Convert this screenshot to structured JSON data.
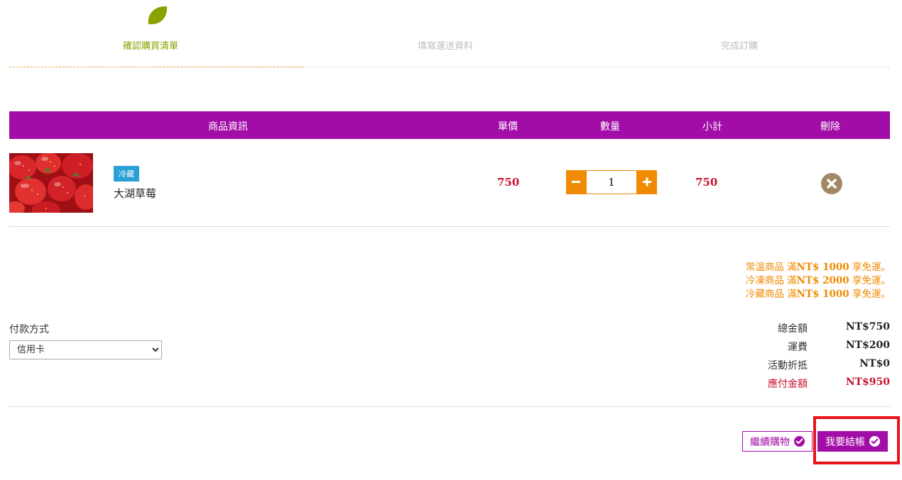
{
  "steps": {
    "step1": "確認購買清單",
    "step2": "填寫運送資料",
    "step3": "完成訂購",
    "step1_icon": "leaf-icon",
    "active_color": "#8aa100"
  },
  "table": {
    "headers": {
      "info": "商品資訊",
      "price": "單價",
      "qty": "數量",
      "subtotal": "小計",
      "delete": "刪除"
    },
    "header_color": "#a20ca7"
  },
  "cart": {
    "items": [
      {
        "tag": "冷藏",
        "name": "大湖草莓",
        "image": "strawberries-photo",
        "price": "750",
        "qty": "1",
        "subtotal": "750",
        "minus_icon": "minus-icon",
        "plus_icon": "plus-icon",
        "delete_icon": "close-circle-icon"
      }
    ]
  },
  "shipping_notes": {
    "line1_prefix": "常溫商品 滿",
    "line1_amount": "NT$ 1000",
    "line1_suffix": " 享免運。",
    "line2_prefix": "冷凍商品 滿",
    "line2_amount": "NT$ 2000",
    "line2_suffix": " 享免運。",
    "line3_prefix": "冷藏商品 滿",
    "line3_amount": "NT$ 1000",
    "line3_suffix": " 享免運。",
    "color": "#f08a00"
  },
  "payment": {
    "label": "付款方式",
    "selected": "信用卡"
  },
  "totals": {
    "total_label": "總金額",
    "total_value": "NT$750",
    "shipping_label": "運費",
    "shipping_value": "NT$200",
    "discount_label": "活動折抵",
    "discount_value": "NT$0",
    "payable_label": "應付金額",
    "payable_value": "NT$950",
    "payable_color": "#c8102e"
  },
  "actions": {
    "continue_label": "繼續購物",
    "checkout_label": "我要結帳",
    "icon": "check-circle-icon",
    "highlight_color": "#e8141c"
  }
}
